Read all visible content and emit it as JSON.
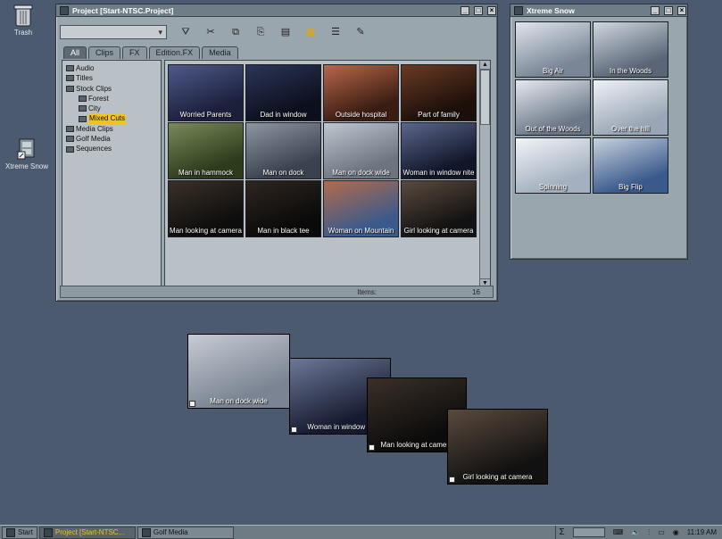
{
  "desktop": {
    "trash_label": "Trash",
    "xtreme_label": "Xtreme Snow"
  },
  "project_window": {
    "title": "Project [Start-NTSC.Project]",
    "tabs": [
      "All",
      "Clips",
      "FX",
      "Edition.FX",
      "Media"
    ],
    "active_tab": "All",
    "tree": [
      {
        "label": "Audio",
        "level": 1
      },
      {
        "label": "Titles",
        "level": 1
      },
      {
        "label": "Stock Clips",
        "level": 1
      },
      {
        "label": "Forest",
        "level": 2
      },
      {
        "label": "City",
        "level": 2
      },
      {
        "label": "Mixed Cuts",
        "level": 2,
        "selected": true
      },
      {
        "label": "Media Clips",
        "level": 1
      },
      {
        "label": "Golf Media",
        "level": 1
      },
      {
        "label": "Sequences",
        "level": 1
      }
    ],
    "clips": [
      {
        "label": "Worried Parents",
        "colors": [
          "#1b1f3a",
          "#4f5a8a"
        ]
      },
      {
        "label": "Dad in window",
        "colors": [
          "#0c0f1d",
          "#2c3558"
        ]
      },
      {
        "label": "Outside hospital",
        "colors": [
          "#3a1c12",
          "#b8674a"
        ]
      },
      {
        "label": "Part of family",
        "colors": [
          "#1c0f0a",
          "#6a3b24"
        ]
      },
      {
        "label": "Man in hammock",
        "colors": [
          "#2d3a1c",
          "#7a8a5a"
        ]
      },
      {
        "label": "Man on dock",
        "colors": [
          "#3a4250",
          "#8e96a2"
        ]
      },
      {
        "label": "Man on dock wide",
        "colors": [
          "#6c7480",
          "#bfc6cf"
        ]
      },
      {
        "label": "Woman in window nite",
        "colors": [
          "#101528",
          "#5b668c"
        ]
      },
      {
        "label": "Man looking at camera",
        "colors": [
          "#0d0d0d",
          "#3a3028"
        ]
      },
      {
        "label": "Man in black tee",
        "colors": [
          "#0a0a0a",
          "#2e2620"
        ]
      },
      {
        "label": "Woman on Mountain",
        "colors": [
          "#3a5a8c",
          "#b26b4a"
        ]
      },
      {
        "label": "Girl looking at camera",
        "colors": [
          "#121212",
          "#5a4a3e"
        ]
      }
    ],
    "status": {
      "items_label": "Items:",
      "items_count": "16"
    }
  },
  "snow_window": {
    "title": "Xtreme Snow",
    "clips": [
      {
        "label": "Big Air",
        "colors": [
          "#7a8696",
          "#dfe5ec"
        ]
      },
      {
        "label": "In the Woods",
        "colors": [
          "#5a6676",
          "#d0d7df"
        ]
      },
      {
        "label": "Out of the Woods",
        "colors": [
          "#6c7888",
          "#e4e9ee"
        ]
      },
      {
        "label": "Over the hill",
        "colors": [
          "#9aa6b5",
          "#eef2f6"
        ]
      },
      {
        "label": "Spinning",
        "colors": [
          "#a4b0bf",
          "#f2f5f8"
        ]
      },
      {
        "label": "Big Flip",
        "colors": [
          "#3a5a8c",
          "#c8d2de"
        ]
      }
    ]
  },
  "floating_clips": [
    {
      "label": "Man on dock wide",
      "colors": [
        "#7b8492",
        "#c6ccd5"
      ]
    },
    {
      "label": "Woman in window ni",
      "colors": [
        "#151a2e",
        "#6d7898"
      ]
    },
    {
      "label": "Man looking at camera",
      "colors": [
        "#0b0b0b",
        "#3a3028"
      ]
    },
    {
      "label": "Girl looking at camera",
      "colors": [
        "#111111",
        "#5a4a3e"
      ]
    }
  ],
  "taskbar": {
    "start_label": "Start",
    "items": [
      {
        "label": "Project [Start-NTSC...",
        "active": true
      },
      {
        "label": "Golf Media",
        "active": false
      }
    ],
    "tray_sigma": "Σ",
    "clock": "11:19 AM"
  }
}
